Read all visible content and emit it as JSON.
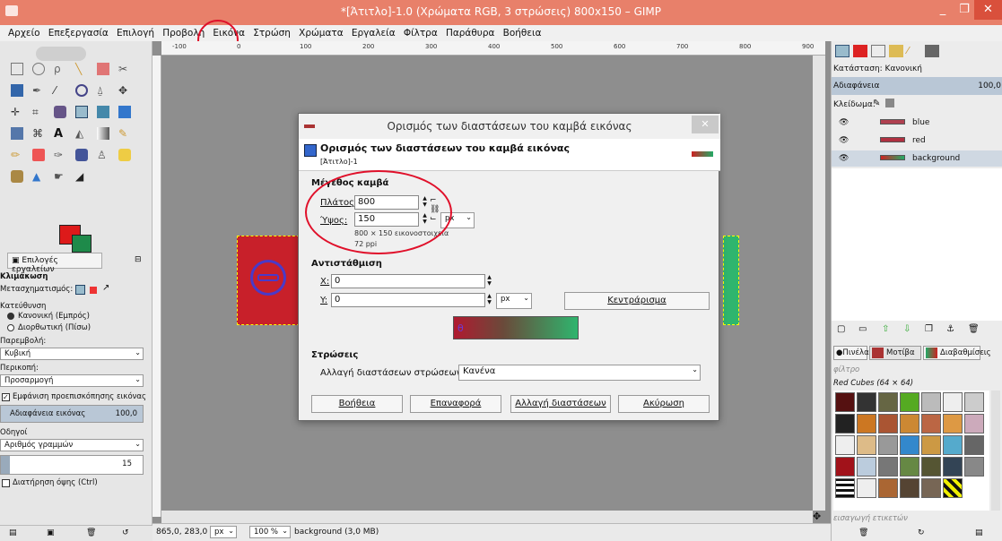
{
  "window": {
    "title": "*[Άτιτλο]-1.0 (Χρώματα RGB, 3 στρώσεις) 800x150 – GIMP",
    "min": "_",
    "max": "❐",
    "close": "✕"
  },
  "menu": [
    "Αρχείο",
    "Επεξεργασία",
    "Επιλογή",
    "Προβολή",
    "Εικόνα",
    "Στρώση",
    "Χρώματα",
    "Εργαλεία",
    "Φίλτρα",
    "Παράθυρα",
    "Βοήθεια"
  ],
  "ruler": [
    "-100",
    "0",
    "100",
    "200",
    "300",
    "400",
    "500",
    "600",
    "700",
    "800",
    "900"
  ],
  "toolbox": {
    "tab_label": "Επιλογές εργαλείων",
    "tool_name": "Κλιμάκωση",
    "transform_label": "Μετασχηματισμός:",
    "direction_label": "Κατεύθυνση",
    "dir_normal": "Κανονική (Εμπρός)",
    "dir_corrective": "Διορθωτική (Πίσω)",
    "interp_label": "Παρεμβολή:",
    "interp_value": "Κυβική",
    "clip_label": "Περικοπή:",
    "clip_value": "Προσαρμογή",
    "preview_label": "Εμφάνιση προεπισκόπησης εικόνας",
    "opacity_label": "Αδιαφάνεια εικόνας",
    "opacity_value": "100,0",
    "guides_label": "Οδηγοί",
    "guides_value": "Αριθμός γραμμών",
    "guides_count": "15",
    "keep_aspect": "Διατήρηση όψης  (Ctrl)"
  },
  "status": {
    "coords": "865,0, 283,0",
    "unit": "px",
    "zoom": "100 %",
    "info": "background (3,0 MB)"
  },
  "layers_dock": {
    "mode_label": "Κατάσταση: Κανονική",
    "opacity_label": "Αδιαφάνεια",
    "opacity_value": "100,0",
    "lock_label": "Κλείδωμα:",
    "layers": [
      {
        "name": "blue"
      },
      {
        "name": "red"
      },
      {
        "name": "background"
      }
    ]
  },
  "patterns_dock": {
    "tabs": [
      "Πινέλα",
      "Μοτίβα",
      "Διαβαθμίσεις"
    ],
    "filter_placeholder": "φίλτρο",
    "pattern_name": "Red Cubes (64 × 64)",
    "tags_placeholder": "εισαγωγή ετικετών"
  },
  "dialog": {
    "title": "Ορισμός των διαστάσεων του καμβά εικόνας",
    "heading": "Ορισμός των διαστάσεων του καμβά εικόνας",
    "subheading": "[Άτιτλο]-1",
    "canvas_section": "Μέγεθος καμβά",
    "width_label": "Πλάτος:",
    "width_value": "800",
    "height_label": "Ύψος:",
    "height_value": "150",
    "unit": "px",
    "size_info": "800 × 150 εικονοστοιχεία",
    "ppi_info": "72 ppi",
    "offset_section": "Αντιστάθμιση",
    "x_label": "X:",
    "x_value": "0",
    "y_label": "Y:",
    "y_value": "0",
    "offset_unit": "px",
    "center_button": "Κεντράρισμα",
    "layers_section": "Στρώσεις",
    "resize_layers_label": "Αλλαγή διαστάσεων στρώσεων:",
    "resize_layers_value": "Κανένα",
    "buttons": {
      "help": "Βοήθεια",
      "reset": "Επαναφορά",
      "resize": "Αλλαγή διαστάσεων",
      "cancel": "Ακύρωση"
    }
  },
  "colors": {
    "titlebar": "#e8806a",
    "fg": "#dd1a1a",
    "bg": "#1e8a4a",
    "annotation": "#e0102a"
  }
}
